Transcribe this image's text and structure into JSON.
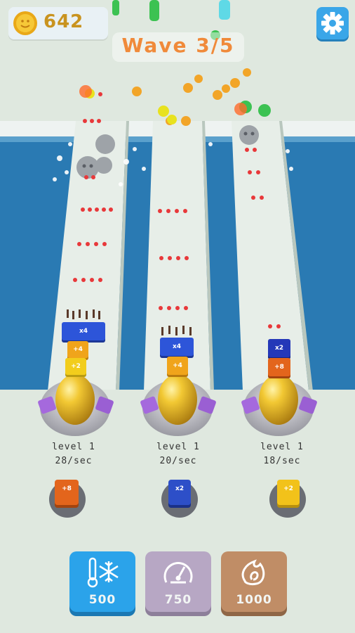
{
  "hud": {
    "coins": "642",
    "wave_label": "Wave 3/5",
    "settings_icon": "gear-icon",
    "coin_icon": "coin-icon"
  },
  "lanes": [
    {
      "level": "level 1",
      "rate": "28/sec",
      "stack": [
        "x4",
        "+4",
        "+2"
      ],
      "slot_block": "+8",
      "slot_color": "#e3651c"
    },
    {
      "level": "level 1",
      "rate": "20/sec",
      "stack": [
        "x4",
        "+4"
      ],
      "slot_block": "x2",
      "slot_color": "#2d4fc8"
    },
    {
      "level": "level 1",
      "rate": "18/sec",
      "stack": [
        "x2",
        "+8"
      ],
      "slot_block": "+2",
      "slot_color": "#f2c21a"
    }
  ],
  "powerups": [
    {
      "name": "freeze",
      "icon": "snowflake-thermometer-icon",
      "price": "500",
      "color": "#2ba3ea"
    },
    {
      "name": "speed",
      "icon": "speedometer-icon",
      "price": "750",
      "color": "#b7a7c4"
    },
    {
      "name": "fire",
      "icon": "flame-swirl-icon",
      "price": "1000",
      "color": "#c08d66"
    }
  ],
  "colors": {
    "water": "#2a7ab3",
    "lane": "#e6ede6",
    "cannon_gold": "#e2b322",
    "cannon_purple": "#a569dd"
  }
}
